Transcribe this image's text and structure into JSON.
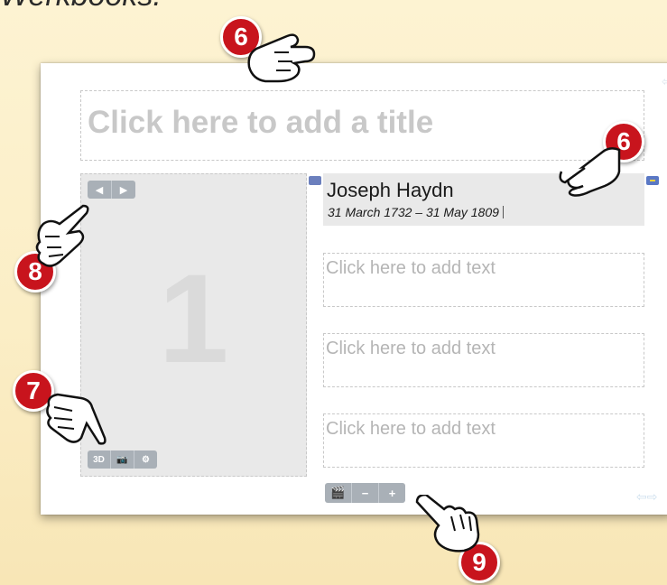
{
  "header": {
    "partial_title": "Werkbooks."
  },
  "slide": {
    "title_placeholder": "Click here to add a title",
    "media": {
      "slide_number": "1",
      "nav": {
        "prev": "◀",
        "next": "▶"
      },
      "buttons": [
        "3D",
        "📷",
        "⚙"
      ]
    },
    "caption": {
      "name": "Joseph Haydn",
      "dates": "31 March 1732 – 31 May 1809"
    },
    "text_placeholders": [
      "Click here to add text",
      "Click here to add text",
      "Click here to add text"
    ],
    "bottom_buttons": [
      "🎬",
      "−",
      "+"
    ]
  },
  "callouts": [
    "6",
    "6",
    "7",
    "8",
    "9"
  ]
}
